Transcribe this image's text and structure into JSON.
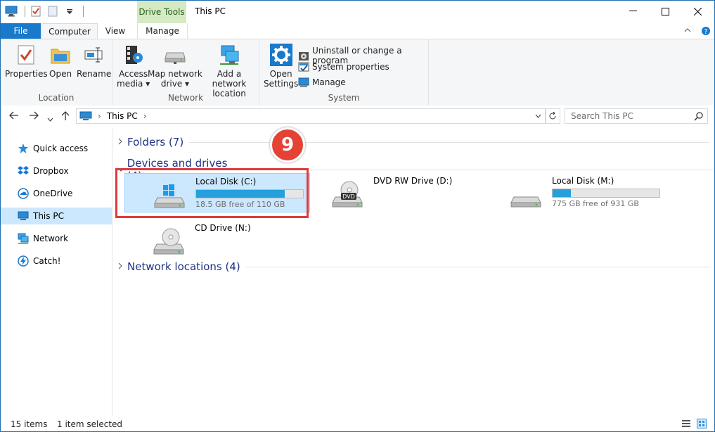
{
  "window": {
    "title": "This PC",
    "context_tab_header": "Drive Tools"
  },
  "ribbon_tabs": {
    "file": "File",
    "computer": "Computer",
    "view": "View",
    "manage": "Manage"
  },
  "ribbon": {
    "location": {
      "label": "Location",
      "properties": "Properties",
      "open": "Open",
      "rename": "Rename"
    },
    "network": {
      "label": "Network",
      "access_media_1": "Access",
      "access_media_2": "media ▾",
      "map_drive_1": "Map network",
      "map_drive_2": "drive ▾",
      "add_location_1": "Add a network",
      "add_location_2": "location"
    },
    "system": {
      "label": "System",
      "open_settings_1": "Open",
      "open_settings_2": "Settings",
      "uninstall": "Uninstall or change a program",
      "system_properties": "System properties",
      "manage": "Manage"
    }
  },
  "address": {
    "path": "This PC",
    "search_placeholder": "Search This PC"
  },
  "sidebar": {
    "items": [
      {
        "label": "Quick access"
      },
      {
        "label": "Dropbox"
      },
      {
        "label": "OneDrive"
      },
      {
        "label": "This PC"
      },
      {
        "label": "Network"
      },
      {
        "label": "Catch!"
      }
    ]
  },
  "content": {
    "folders": "Folders (7)",
    "devices": "Devices and drives (4)",
    "network_locations": "Network locations (4)",
    "drives": [
      {
        "name": "Local Disk (C:)",
        "free": "18.5 GB free of 110 GB",
        "used_fraction": 0.83
      },
      {
        "name": "DVD RW Drive (D:)"
      },
      {
        "name": "Local Disk (M:)",
        "free": "775 GB free of 931 GB",
        "used_fraction": 0.17
      },
      {
        "name": "CD Drive (N:)"
      }
    ],
    "step_badge": "9"
  },
  "status": {
    "items": "15 items",
    "selected": "1 item selected"
  },
  "colors": {
    "accent": "#1979ca",
    "selection": "#cce8ff",
    "bar_fill": "#26a0da",
    "highlight": "#e03a3a"
  }
}
